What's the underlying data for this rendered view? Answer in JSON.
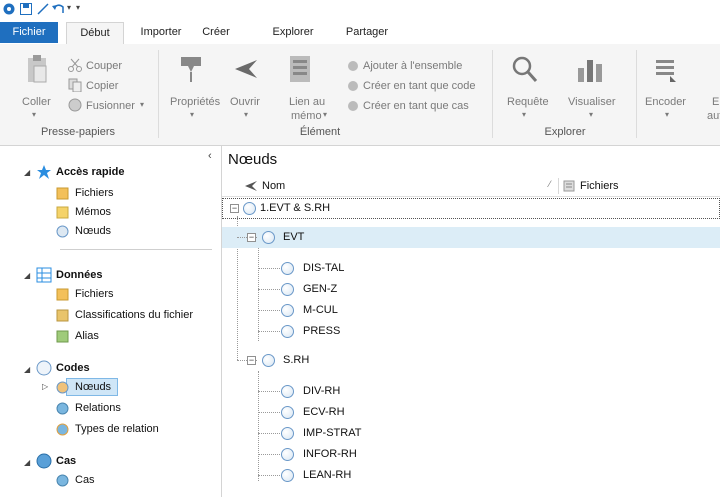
{
  "ribbon_tabs": [
    "Fichier",
    "Début",
    "Importer",
    "Créer",
    "Explorer",
    "Partager"
  ],
  "clipboard": {
    "couper": "Couper",
    "copier": "Copier",
    "coller": "Coller",
    "fusionner": "Fusionner",
    "group": "Presse-papiers"
  },
  "element": {
    "proprietes": "Propriétés",
    "ouvrir": "Ouvrir",
    "lien_au_1": "Lien au",
    "lien_au_2": "mémo",
    "ajouter": "Ajouter à l'ensemble",
    "creer_code": "Créer en tant que code",
    "creer_cas": "Créer en tant que cas",
    "group": "Élément"
  },
  "explorer": {
    "requete": "Requête",
    "visualiser": "Visualiser",
    "group": "Explorer"
  },
  "coding": {
    "encoder": "Encoder",
    "partial_1": "E",
    "partial_2": "aut"
  },
  "nav": {
    "acces_rapide": "Accès rapide",
    "acces_items": [
      "Fichiers",
      "Mémos",
      "Nœuds"
    ],
    "donnees": "Données",
    "donnees_items": [
      "Fichiers",
      "Classifications du fichier",
      "Alias"
    ],
    "codes": "Codes",
    "codes_items": [
      "Nœuds",
      "Relations",
      "Types de relation"
    ],
    "cas": "Cas",
    "cas_items": [
      "Cas"
    ]
  },
  "main": {
    "title": "Nœuds",
    "col_nom": "Nom",
    "col_fichiers": "Fichiers",
    "rows": [
      "1.EVT & S.RH",
      "EVT",
      "DIS-TAL",
      "GEN-Z",
      "M-CUL",
      "PRESS",
      "S.RH",
      "DIV-RH",
      "ECV-RH",
      "IMP-STRAT",
      "INFOR-RH",
      "LEAN-RH"
    ]
  },
  "colors": {
    "file_tab": "#1f6fbf",
    "selection": "#cfe6f7",
    "node_circle": "#6a98c8"
  }
}
